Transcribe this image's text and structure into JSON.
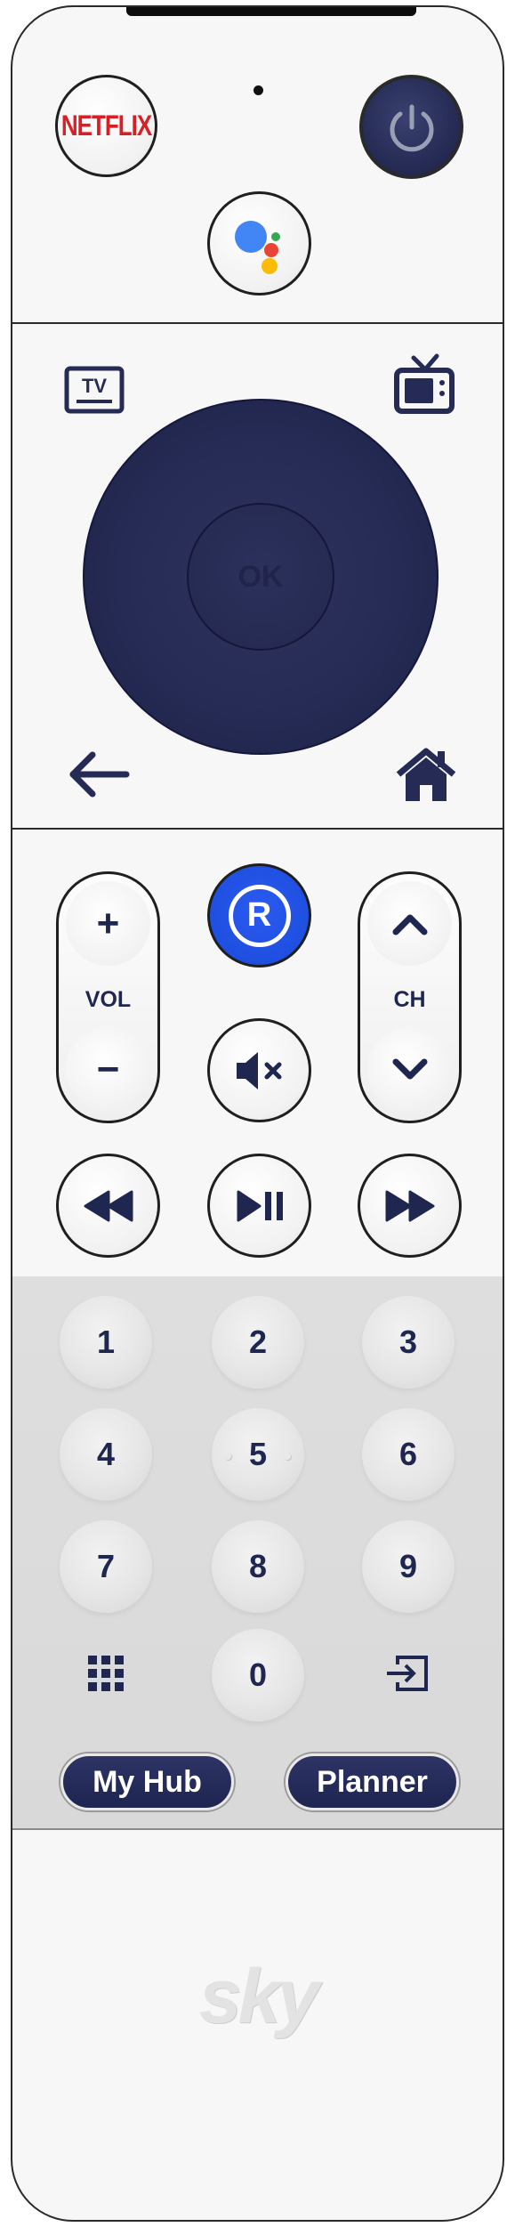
{
  "remote": {
    "netflix_label": "NETFLIX",
    "ok_label": "OK",
    "tv_icon_label": "TV",
    "volume": {
      "plus": "+",
      "label": "VOL",
      "minus": "−"
    },
    "channel": {
      "label": "CH"
    },
    "record_letter": "R",
    "numbers": [
      "1",
      "2",
      "3",
      "4",
      "5",
      "6",
      "7",
      "8",
      "9",
      "0"
    ],
    "my_hub_label": "My Hub",
    "planner_label": "Planner",
    "brand": "sky"
  },
  "colors": {
    "navy": "#262b55",
    "netflix_red": "#d81f26",
    "record_blue": "#1f4fe0",
    "assistant_blue": "#4285f4",
    "assistant_red": "#ea4335",
    "assistant_yellow": "#fbbc05",
    "assistant_green": "#34a853"
  },
  "icons": [
    "google-assistant-icon",
    "power-icon",
    "tv-icon",
    "live-tv-icon",
    "back-arrow-icon",
    "home-icon",
    "mute-icon",
    "rewind-icon",
    "play-pause-icon",
    "fast-forward-icon",
    "grid-icon",
    "input-icon",
    "chevron-up-icon",
    "chevron-down-icon"
  ]
}
